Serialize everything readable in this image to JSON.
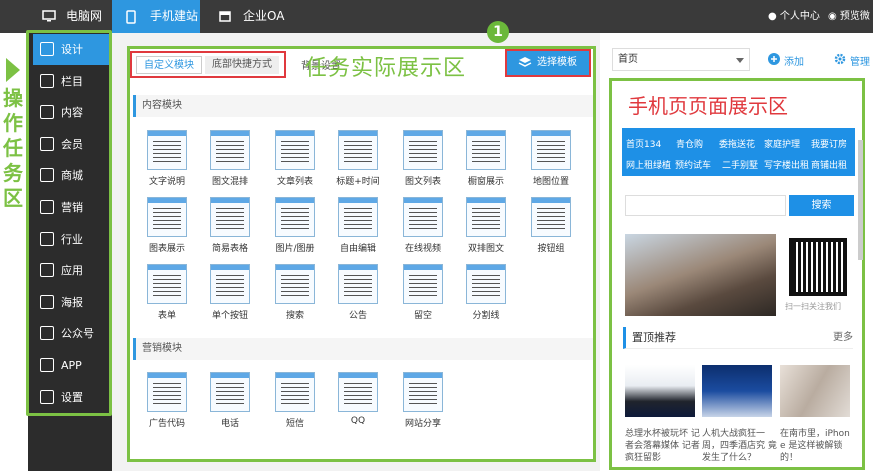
{
  "topbar": {
    "tabs": [
      {
        "label": "电脑网站",
        "icon": "monitor-icon"
      },
      {
        "label": "手机建站",
        "icon": "phone-icon"
      },
      {
        "label": "企业OA",
        "icon": "calendar-icon"
      }
    ],
    "user_center": "个人中心",
    "preview": "预览微站"
  },
  "annotations": {
    "left": "操作任务区",
    "middle": "任务实际展示区",
    "right": "手机页页面展示区",
    "step_number": "1"
  },
  "sidebar": {
    "items": [
      {
        "label": "设计",
        "icon": "design-icon"
      },
      {
        "label": "栏目",
        "icon": "list-icon"
      },
      {
        "label": "内容",
        "icon": "edit-icon"
      },
      {
        "label": "会员",
        "icon": "user-icon"
      },
      {
        "label": "商城",
        "icon": "cart-icon"
      },
      {
        "label": "营销",
        "icon": "marketing-icon"
      },
      {
        "label": "行业",
        "icon": "industry-icon"
      },
      {
        "label": "应用",
        "icon": "apps-icon"
      },
      {
        "label": "海报",
        "icon": "poster-icon"
      },
      {
        "label": "公众号",
        "icon": "wechat-icon"
      },
      {
        "label": "APP",
        "icon": "app-icon"
      },
      {
        "label": "设置",
        "icon": "settings-icon"
      }
    ]
  },
  "editor": {
    "tab_custom": "自定义模块",
    "tab_bottom": "底部快捷方式",
    "bg_setting": "背景设置",
    "select_template": "选择模板",
    "section_content": "内容模块",
    "section_marketing": "营销模块",
    "content_modules": [
      "文字说明",
      "图文混排",
      "文章列表",
      "标题+时间",
      "图文列表",
      "橱窗展示",
      "地图位置",
      "图表展示",
      "简易表格",
      "图片/图册",
      "自由编辑",
      "在线视频",
      "双排图文",
      "按钮组",
      "表单",
      "单个按钮",
      "搜索",
      "公告",
      "留空",
      "分割线"
    ],
    "marketing_modules": [
      "广告代码",
      "电话",
      "短信",
      "QQ",
      "网站分享"
    ]
  },
  "preview": {
    "page_select": "首页",
    "add": "添加",
    "manage": "管理",
    "nav_row1": [
      "首页134",
      "青仓购",
      "委拖送花",
      "家庭护理",
      "我要订房"
    ],
    "nav_row2": [
      "网上租绿植",
      "预约试车",
      "二手别墅",
      "写字楼出租",
      "商铺出租"
    ],
    "search_btn": "搜索",
    "qr_caption": "扫一扫关注我们",
    "rec_title": "置顶推荐",
    "rec_more": "更多",
    "news": [
      "总理水杯被玩坏 记者会落幕媒体 记者疯狂留影",
      "人机大战疯狂一 周，四季酒店究 竟发生了什么？",
      "在南市里，iPhon e 是这样被解锁 的！"
    ]
  }
}
